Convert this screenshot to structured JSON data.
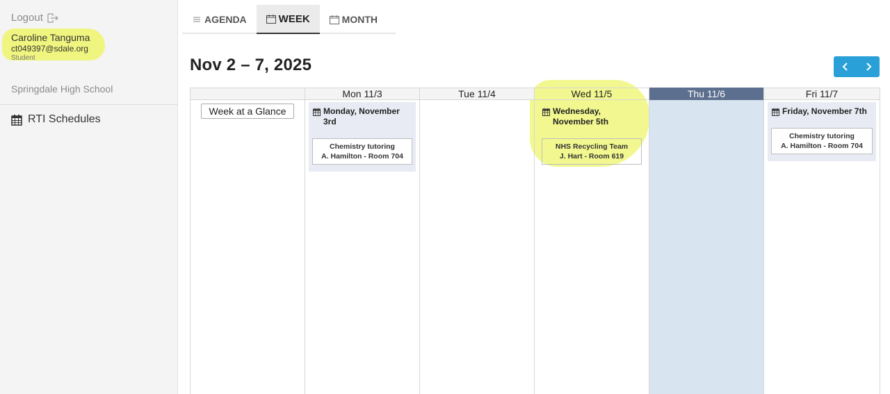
{
  "sidebar": {
    "logout_label": "Logout",
    "user": {
      "name": "Caroline Tanguma",
      "email": "ct049397@sdale.org",
      "role": "Student"
    },
    "school": "Springdale High School",
    "nav": [
      {
        "label": "RTI Schedules",
        "icon": "calendar-icon"
      }
    ]
  },
  "tabs": [
    {
      "label": "AGENDA",
      "icon": "list-icon",
      "active": false
    },
    {
      "label": "WEEK",
      "icon": "calendar-icon",
      "active": true
    },
    {
      "label": "MONTH",
      "icon": "calendar-icon",
      "active": false
    }
  ],
  "title": "Nov 2 – 7, 2025",
  "glance_label": "Week at a Glance",
  "days": [
    {
      "header": "Mon 11/3",
      "label": "Monday, November 3rd",
      "event": {
        "line1": "Chemistry tutoring",
        "line2": "A. Hamilton - Room 704"
      }
    },
    {
      "header": "Tue 11/4"
    },
    {
      "header": "Wed 11/5",
      "label": "Wednesday, November 5th",
      "event": {
        "line1": "NHS Recycling Team",
        "line2": "J. Hart - Room 619"
      }
    },
    {
      "header": "Thu 11/6",
      "today": true
    },
    {
      "header": "Fri 11/7",
      "label": "Friday, November 7th",
      "event": {
        "line1": "Chemistry tutoring",
        "line2": "A. Hamilton - Room 704"
      }
    }
  ],
  "colors": {
    "accent": "#2aa0d8",
    "today_header": "#5c6f8e",
    "today_bg": "#d8e4ef",
    "highlight": "#eef56a"
  }
}
